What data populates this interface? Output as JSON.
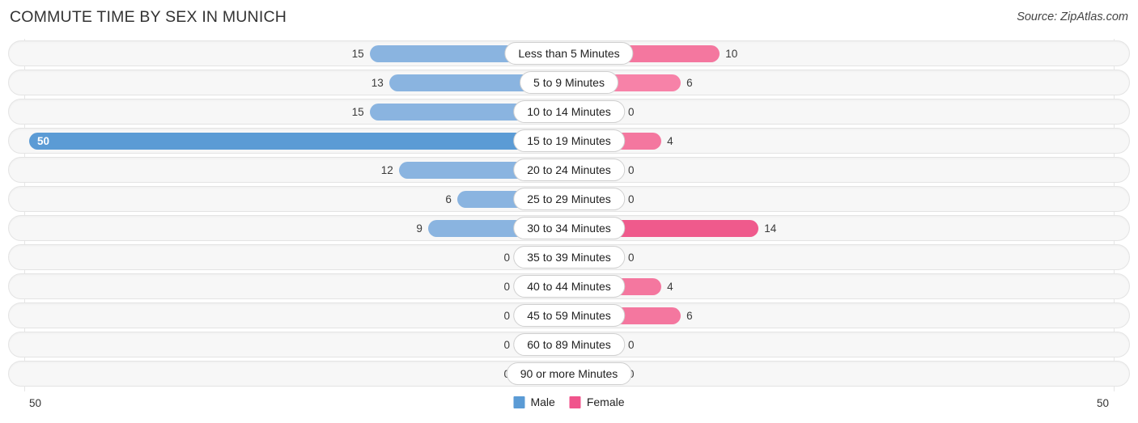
{
  "header": {
    "title": "COMMUTE TIME BY SEX IN MUNICH",
    "source": "Source: ZipAtlas.com"
  },
  "axis": {
    "left_label": "50",
    "right_label": "50",
    "max": 50
  },
  "legend": {
    "items": [
      {
        "label": "Male",
        "color": "#5b9bd5"
      },
      {
        "label": "Female",
        "color": "#f0548c"
      }
    ]
  },
  "colors": {
    "male_light": "#8ab4e0",
    "male_dark": "#5b9bd5",
    "female_lightest": "#f7a8c4",
    "female_light": "#f782a8",
    "female_mid": "#f4779f",
    "female_strong": "#ef5a8c",
    "track_bg": "#f7f7f7",
    "track_border": "#e4e4e4",
    "text": "#333333"
  },
  "chart_data": {
    "type": "bar",
    "title": "COMMUTE TIME BY SEX IN MUNICH",
    "subtitle": "Source: ZipAtlas.com",
    "orientation": "horizontal-diverging",
    "xlabel": "",
    "ylabel": "",
    "xlim": [
      -50,
      50
    ],
    "axis_tick_labels": [
      "50",
      "50"
    ],
    "grid": false,
    "legend_position": "bottom-center",
    "categories": [
      "Less than 5 Minutes",
      "5 to 9 Minutes",
      "10 to 14 Minutes",
      "15 to 19 Minutes",
      "20 to 24 Minutes",
      "25 to 29 Minutes",
      "30 to 34 Minutes",
      "35 to 39 Minutes",
      "40 to 44 Minutes",
      "45 to 59 Minutes",
      "60 to 89 Minutes",
      "90 or more Minutes"
    ],
    "series": [
      {
        "name": "Male",
        "values": [
          15,
          13,
          15,
          50,
          12,
          6,
          9,
          0,
          0,
          0,
          0,
          0
        ]
      },
      {
        "name": "Female",
        "values": [
          10,
          6,
          0,
          4,
          0,
          0,
          14,
          0,
          4,
          6,
          0,
          0
        ]
      }
    ]
  },
  "rows": [
    {
      "label": "Less than 5 Minutes",
      "male": "15",
      "male_value": 15,
      "female": "10",
      "female_value": 10,
      "male_color": "#8ab4e0",
      "female_color": "#f4779f",
      "male_inside": false
    },
    {
      "label": "5 to 9 Minutes",
      "male": "13",
      "male_value": 13,
      "female": "6",
      "female_value": 6,
      "male_color": "#8ab4e0",
      "female_color": "#f782a8",
      "male_inside": false
    },
    {
      "label": "10 to 14 Minutes",
      "male": "15",
      "male_value": 15,
      "female": "0",
      "female_value": 0,
      "male_color": "#8ab4e0",
      "female_color": "#f7a8c4",
      "male_inside": false
    },
    {
      "label": "15 to 19 Minutes",
      "male": "50",
      "male_value": 50,
      "female": "4",
      "female_value": 4,
      "male_color": "#5b9bd5",
      "female_color": "#f4779f",
      "male_inside": true
    },
    {
      "label": "20 to 24 Minutes",
      "male": "12",
      "male_value": 12,
      "female": "0",
      "female_value": 0,
      "male_color": "#8ab4e0",
      "female_color": "#f7a8c4",
      "male_inside": false
    },
    {
      "label": "25 to 29 Minutes",
      "male": "6",
      "male_value": 6,
      "female": "0",
      "female_value": 0,
      "male_color": "#8ab4e0",
      "female_color": "#f7a8c4",
      "male_inside": false
    },
    {
      "label": "30 to 34 Minutes",
      "male": "9",
      "male_value": 9,
      "female": "14",
      "female_value": 14,
      "male_color": "#8ab4e0",
      "female_color": "#ef5a8c",
      "male_inside": false
    },
    {
      "label": "35 to 39 Minutes",
      "male": "0",
      "male_value": 0,
      "female": "0",
      "female_value": 0,
      "male_color": "#adc9ea",
      "female_color": "#f7a8c4",
      "male_inside": false
    },
    {
      "label": "40 to 44 Minutes",
      "male": "0",
      "male_value": 0,
      "female": "4",
      "female_value": 4,
      "male_color": "#adc9ea",
      "female_color": "#f4779f",
      "male_inside": false
    },
    {
      "label": "45 to 59 Minutes",
      "male": "0",
      "male_value": 0,
      "female": "6",
      "female_value": 6,
      "male_color": "#adc9ea",
      "female_color": "#f4779f",
      "male_inside": false
    },
    {
      "label": "60 to 89 Minutes",
      "male": "0",
      "male_value": 0,
      "female": "0",
      "female_value": 0,
      "male_color": "#adc9ea",
      "female_color": "#f7a8c4",
      "male_inside": false
    },
    {
      "label": "90 or more Minutes",
      "male": "0",
      "male_value": 0,
      "female": "0",
      "female_value": 0,
      "male_color": "#adc9ea",
      "female_color": "#f7a8c4",
      "male_inside": false
    }
  ]
}
